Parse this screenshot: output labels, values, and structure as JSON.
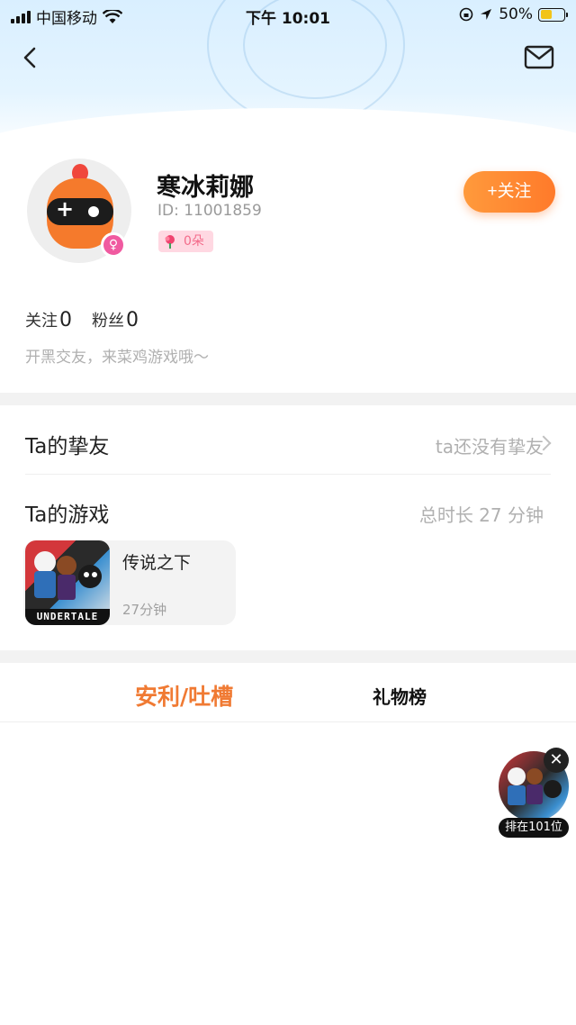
{
  "status_bar": {
    "carrier": "中国移动",
    "time": "下午 10:01",
    "battery": "50%"
  },
  "profile": {
    "name": "寒冰莉娜",
    "id": "ID: 11001859",
    "flowers": "0朵",
    "follow_label": "+关注",
    "following_label": "关注",
    "following_count": "0",
    "fans_label": "粉丝",
    "fans_count": "0",
    "bio": "开黑交友，来菜鸡游戏哦～"
  },
  "friends": {
    "label": "Ta的挚友",
    "empty_text": "ta还没有挚友"
  },
  "games": {
    "label": "Ta的游戏",
    "total": "总时长 27 分钟",
    "items": [
      {
        "name": "传说之下",
        "time": "27分钟",
        "thumb_text": "UNDERTALE"
      }
    ]
  },
  "tabs": [
    {
      "label": "安利/吐槽",
      "active": true
    },
    {
      "label": "礼物榜",
      "active": false
    }
  ],
  "float_widget": {
    "rank": "排在101位"
  },
  "colors": {
    "accent": "#f07a33",
    "follow_gradient_start": "#ff9a3c",
    "follow_gradient_end": "#ff7a2a",
    "flower_chip_bg": "#ffd8e2"
  }
}
